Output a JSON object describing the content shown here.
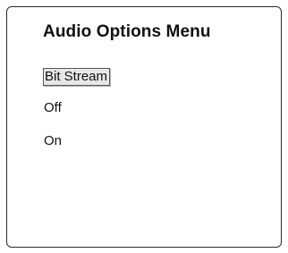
{
  "menu": {
    "title": "Audio Options Menu",
    "options": [
      {
        "label": "Bit Stream",
        "selected": true
      },
      {
        "label": "Off",
        "selected": false
      },
      {
        "label": "On",
        "selected": false
      }
    ]
  }
}
